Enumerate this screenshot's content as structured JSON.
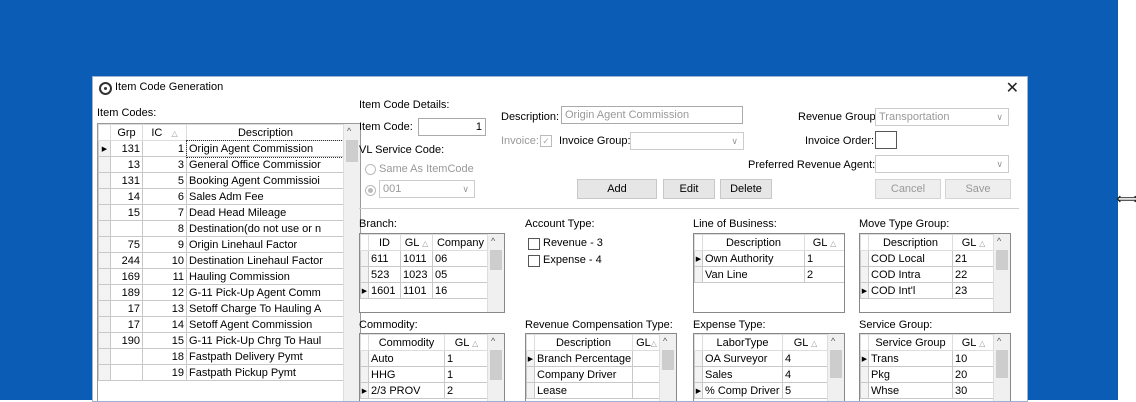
{
  "window": {
    "title": "Item Code Generation",
    "close": "✕"
  },
  "left": {
    "label": "Item Codes:",
    "headers": {
      "grp": "Grp",
      "ic": "IC",
      "sort": "△",
      "desc": "Description",
      "scroll_up": "^"
    },
    "rows": [
      {
        "grp": "131",
        "ic": "1",
        "desc": "Origin Agent Commission",
        "marker": "▶"
      },
      {
        "grp": "13",
        "ic": "3",
        "desc": "General Office Commissior",
        "marker": ""
      },
      {
        "grp": "131",
        "ic": "5",
        "desc": "Booking Agent Commissioi",
        "marker": ""
      },
      {
        "grp": "14",
        "ic": "6",
        "desc": "Sales Adm Fee",
        "marker": ""
      },
      {
        "grp": "15",
        "ic": "7",
        "desc": "Dead Head Mileage",
        "marker": ""
      },
      {
        "grp": "",
        "ic": "8",
        "desc": "Destination(do not use or n",
        "marker": ""
      },
      {
        "grp": "75",
        "ic": "9",
        "desc": "Origin Linehaul Factor",
        "marker": ""
      },
      {
        "grp": "244",
        "ic": "10",
        "desc": "Destination Linehaul Factor",
        "marker": ""
      },
      {
        "grp": "169",
        "ic": "11",
        "desc": "Hauling Commission",
        "marker": ""
      },
      {
        "grp": "189",
        "ic": "12",
        "desc": "G-11 Pick-Up Agent Comm",
        "marker": ""
      },
      {
        "grp": "17",
        "ic": "13",
        "desc": "Setoff Charge To Hauling A",
        "marker": ""
      },
      {
        "grp": "17",
        "ic": "14",
        "desc": "Setoff Agent Commission",
        "marker": ""
      },
      {
        "grp": "190",
        "ic": "15",
        "desc": "G-11 Pick-Up Chrg To Haul",
        "marker": ""
      },
      {
        "grp": "",
        "ic": "18",
        "desc": "Fastpath Delivery Pymt",
        "marker": ""
      },
      {
        "grp": "",
        "ic": "19",
        "desc": "Fastpath Pickup Pymt",
        "marker": ""
      }
    ]
  },
  "details": {
    "section_label": "Item Code Details:",
    "item_code_label": "Item Code:",
    "item_code_value": "1",
    "vl_label": "VL Service Code:",
    "same_as": "Same As ItemCode",
    "service_code": "001",
    "description_label": "Description:",
    "description_value": "Origin Agent Commission",
    "invoice_label": "Invoice:",
    "invoice_check": "✓",
    "invoice_group_label": "Invoice Group:",
    "invoice_group_value": "",
    "revenue_group_label": "Revenue Group:",
    "revenue_group_value": "Transportation",
    "invoice_order_label": "Invoice Order:",
    "pref_agent_label": "Preferred Revenue Agent:",
    "buttons": {
      "add": "Add",
      "edit": "Edit",
      "delete": "Delete",
      "cancel": "Cancel",
      "save": "Save"
    }
  },
  "branch": {
    "label": "Branch:",
    "headers": [
      "ID",
      "GL",
      "△",
      "Company",
      "^"
    ],
    "rows": [
      {
        "marker": "",
        "c": [
          "611",
          "1011",
          "06"
        ]
      },
      {
        "marker": "",
        "c": [
          "523",
          "1023",
          "05"
        ]
      },
      {
        "marker": "▶",
        "c": [
          "1601",
          "1101",
          "16"
        ]
      }
    ]
  },
  "account_type": {
    "label": "Account Type:",
    "options": [
      "Revenue - 3",
      "Expense - 4"
    ]
  },
  "lob": {
    "label": "Line of Business:",
    "headers": [
      "Description",
      "GL",
      "△"
    ],
    "rows": [
      {
        "marker": "▶",
        "c": [
          "Own Authority",
          "1"
        ]
      },
      {
        "marker": "",
        "c": [
          "Van Line",
          "2"
        ]
      }
    ]
  },
  "move_type": {
    "label": "Move Type Group:",
    "headers": [
      "Description",
      "GL",
      "△",
      "^"
    ],
    "rows": [
      {
        "marker": "",
        "c": [
          "COD Local",
          "21"
        ]
      },
      {
        "marker": "",
        "c": [
          "COD Intra",
          "22"
        ]
      },
      {
        "marker": "▶",
        "c": [
          "COD Int'l",
          "23"
        ]
      }
    ]
  },
  "commodity": {
    "label": "Commodity:",
    "headers": [
      "Commodity",
      "GL",
      "△",
      "^"
    ],
    "rows": [
      {
        "marker": "",
        "c": [
          "Auto",
          "1"
        ]
      },
      {
        "marker": "",
        "c": [
          "HHG",
          "1"
        ]
      },
      {
        "marker": "▶",
        "c": [
          "2/3 PROV",
          "2"
        ]
      }
    ]
  },
  "rev_comp": {
    "label": "Revenue Compensation Type:",
    "headers": [
      "Description",
      "GL",
      "△",
      "^"
    ],
    "rows": [
      {
        "marker": "▶",
        "c": [
          "Branch Percentage",
          ""
        ]
      },
      {
        "marker": "",
        "c": [
          "Company Driver",
          ""
        ]
      },
      {
        "marker": "",
        "c": [
          "Lease",
          ""
        ]
      }
    ]
  },
  "expense_type": {
    "label": "Expense Type:",
    "headers": [
      "LaborType",
      "GL",
      "△",
      "^"
    ],
    "rows": [
      {
        "marker": "",
        "c": [
          "OA Surveyor",
          "4"
        ]
      },
      {
        "marker": "",
        "c": [
          "Sales",
          "4"
        ]
      },
      {
        "marker": "▶",
        "c": [
          "% Comp Driver",
          "5"
        ]
      }
    ]
  },
  "service_group": {
    "label": "Service Group:",
    "headers": [
      "Service Group",
      "GL",
      "△",
      "^"
    ],
    "rows": [
      {
        "marker": "▶",
        "c": [
          "Trans",
          "10"
        ]
      },
      {
        "marker": "",
        "c": [
          "Pkg",
          "20"
        ]
      },
      {
        "marker": "",
        "c": [
          "Whse",
          "30"
        ]
      }
    ]
  },
  "resize_glyph": "⟺"
}
